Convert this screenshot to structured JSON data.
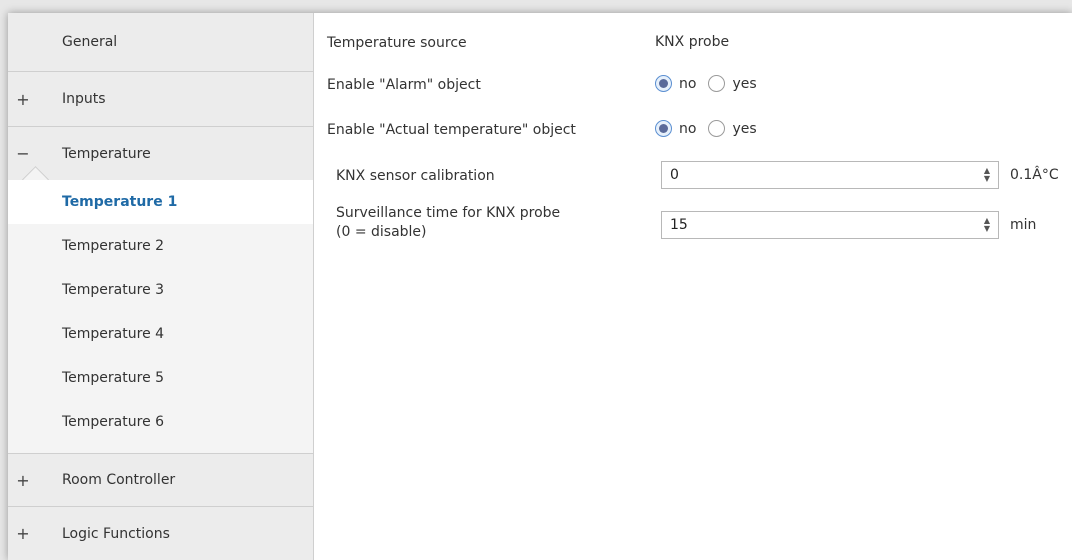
{
  "sidebar": {
    "items": [
      {
        "label": "General",
        "sign": ""
      },
      {
        "label": "Inputs",
        "sign": "+"
      },
      {
        "label": "Temperature",
        "sign": "−"
      },
      {
        "label": "Room Controller",
        "sign": "+"
      },
      {
        "label": "Logic Functions",
        "sign": "+"
      }
    ],
    "children": [
      {
        "label": "Temperature 1"
      },
      {
        "label": "Temperature 2"
      },
      {
        "label": "Temperature 3"
      },
      {
        "label": "Temperature 4"
      },
      {
        "label": "Temperature 5"
      },
      {
        "label": "Temperature 6"
      }
    ]
  },
  "main": {
    "temperature_source": {
      "label": "Temperature source",
      "value": "KNX probe"
    },
    "alarm_object": {
      "label": "Enable \"Alarm\" object",
      "options": [
        "no",
        "yes"
      ],
      "selected": "no"
    },
    "actual_temp_object": {
      "label": "Enable \"Actual temperature\" object",
      "options": [
        "no",
        "yes"
      ],
      "selected": "no"
    },
    "calibration": {
      "label": "KNX sensor calibration",
      "value": "0",
      "unit": "0.1Â°C"
    },
    "surveillance": {
      "label_line1": "Surveillance time for KNX probe",
      "label_line2": "(0 = disable)",
      "value": "15",
      "unit": "min"
    }
  },
  "colors": {
    "active_text": "#1f6aa6",
    "sidebar_bg": "#ececec"
  }
}
